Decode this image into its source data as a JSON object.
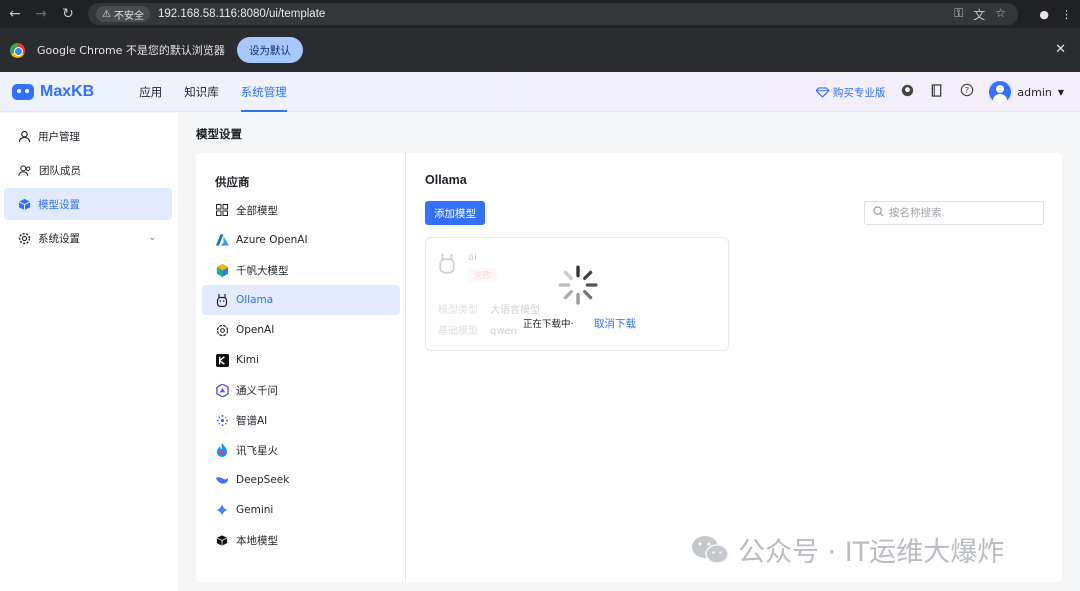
{
  "browser": {
    "security_label": "不安全",
    "url": "192.168.58.116:8080/ui/template",
    "infobar_text": "Google Chrome 不是您的默认浏览器",
    "infobar_button": "设为默认"
  },
  "header": {
    "brand": "MaxKB",
    "nav": [
      {
        "label": "应用"
      },
      {
        "label": "知识库"
      },
      {
        "label": "系统管理"
      }
    ],
    "buy_pro": "购买专业版",
    "username": "admin"
  },
  "sidebar": {
    "items": [
      {
        "label": "用户管理",
        "icon": "user-icon"
      },
      {
        "label": "团队成员",
        "icon": "team-icon"
      },
      {
        "label": "模型设置",
        "icon": "cube-icon"
      },
      {
        "label": "系统设置",
        "icon": "gear-icon"
      }
    ]
  },
  "main": {
    "page_title": "模型设置",
    "provider_heading": "供应商",
    "providers": [
      {
        "label": "全部模型"
      },
      {
        "label": "Azure OpenAI"
      },
      {
        "label": "千帆大模型"
      },
      {
        "label": "Ollama"
      },
      {
        "label": "OpenAI"
      },
      {
        "label": "Kimi"
      },
      {
        "label": "通义千问"
      },
      {
        "label": "智谱AI"
      },
      {
        "label": "讯飞星火"
      },
      {
        "label": "DeepSeek"
      },
      {
        "label": "Gemini"
      },
      {
        "label": "本地模型"
      }
    ],
    "selected_provider": "Ollama",
    "add_button": "添加模型",
    "search_placeholder": "按名称搜索",
    "card": {
      "name": "ai",
      "tag": "失败",
      "type_label": "模型类型",
      "type_value": "大语言模型",
      "base_label": "基础模型",
      "base_value": "qwen",
      "loading_text": "正在下载中·",
      "cancel_label": "取消下载"
    }
  },
  "watermark": "公众号 · IT运维大爆炸",
  "colors": {
    "accent": "#3370ff",
    "active_bg": "#e1eaff",
    "danger": "#f54a45"
  }
}
